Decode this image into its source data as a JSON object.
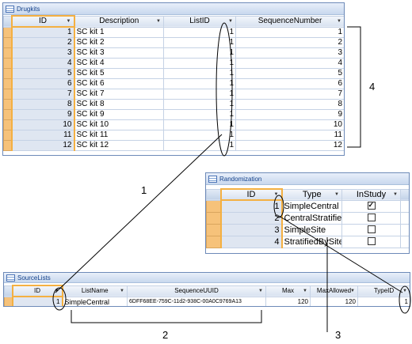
{
  "drugkits": {
    "title": "Drugkits",
    "columns": [
      "ID",
      "Description",
      "ListID",
      "SequenceNumber"
    ],
    "rows": [
      [
        "1",
        "SC kit 1",
        "1",
        "1"
      ],
      [
        "2",
        "SC kit 2",
        "1",
        "2"
      ],
      [
        "3",
        "SC kit 3",
        "1",
        "3"
      ],
      [
        "4",
        "SC kit 4",
        "1",
        "4"
      ],
      [
        "5",
        "SC kit 5",
        "1",
        "5"
      ],
      [
        "6",
        "SC kit 6",
        "1",
        "6"
      ],
      [
        "7",
        "SC kit 7",
        "1",
        "7"
      ],
      [
        "8",
        "SC kit 8",
        "1",
        "8"
      ],
      [
        "9",
        "SC kit 9",
        "1",
        "9"
      ],
      [
        "10",
        "SC kit 10",
        "1",
        "10"
      ],
      [
        "11",
        "SC kit 11",
        "1",
        "11"
      ],
      [
        "12",
        "SC kit 12",
        "1",
        "12"
      ]
    ]
  },
  "randomization": {
    "title": "Randomization",
    "columns": [
      "ID",
      "Type",
      "InStudy"
    ],
    "rows": [
      {
        "id": "1",
        "type": "SimpleCentral",
        "instudy": true
      },
      {
        "id": "2",
        "type": "CentralStratifie",
        "instudy": false
      },
      {
        "id": "3",
        "type": "SimpleSite",
        "instudy": false
      },
      {
        "id": "4",
        "type": "StratifiedBySite",
        "instudy": false
      }
    ]
  },
  "sourcelists": {
    "title": "SourceLists",
    "columns": [
      "ID",
      "ListName",
      "SequenceUUID",
      "Max",
      "MaxAllowed",
      "TypeID"
    ],
    "row": [
      "1",
      "SimpleCentral",
      "6DFF68EE-759C-11d2-938C-00A0C9769A13",
      "120",
      "120",
      "1"
    ]
  },
  "annotations": [
    "1",
    "2",
    "3",
    "4"
  ]
}
